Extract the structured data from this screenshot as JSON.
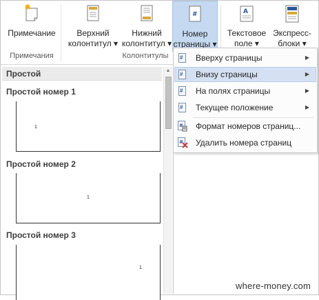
{
  "ribbon": {
    "note_button": {
      "line1": "Примечание",
      "line2": ""
    },
    "group_notes": "Примечания",
    "header_button": {
      "line1": "Верхний",
      "line2": "колонтитул ▾"
    },
    "footer_button": {
      "line1": "Нижний",
      "line2": "колонтитул ▾"
    },
    "page_number_button": {
      "line1": "Номер",
      "line2": "страницы ▾"
    },
    "group_headers": "Колонтитулы",
    "text_field_button": {
      "line1": "Текстовое",
      "line2": "поле ▾"
    },
    "quick_parts_button": {
      "line1": "Экспресс-",
      "line2": "блоки ▾"
    }
  },
  "gallery": {
    "section_title": "Простой",
    "items": [
      {
        "title": "Простой номер 1",
        "number": "1"
      },
      {
        "title": "Простой номер 2",
        "number": "1"
      },
      {
        "title": "Простой номер 3",
        "number": "1"
      }
    ]
  },
  "menu": {
    "items": [
      {
        "label": "Вверху страницы",
        "icon": "page-number-icon",
        "submenu": true
      },
      {
        "label": "Внизу страницы",
        "icon": "page-number-icon",
        "submenu": true,
        "highlighted": true
      },
      {
        "label": "На полях страницы",
        "icon": "page-number-icon",
        "submenu": true
      },
      {
        "label": "Текущее положение",
        "icon": "page-number-icon",
        "submenu": true
      },
      {
        "label": "Формат номеров страниц...",
        "icon": "format-page-numbers-icon",
        "submenu": false
      },
      {
        "label": "Удалить номера страниц",
        "icon": "remove-page-numbers-icon",
        "submenu": false
      }
    ]
  },
  "watermark": "where-money.com",
  "colors": {
    "active_button": "#c5d9f1",
    "menu_highlight": "#d5e1f2",
    "accent_blue": "#2b579a",
    "delete_red": "#d13438"
  }
}
